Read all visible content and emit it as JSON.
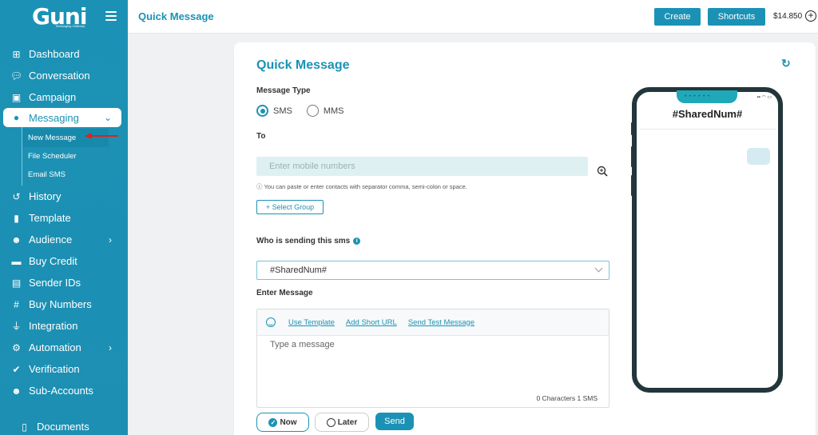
{
  "sidebar": {
    "logo": "Guni",
    "logo_sub": "Messaging Gateway",
    "items": [
      {
        "label": "Dashboard",
        "icon": "dashboard-icon"
      },
      {
        "label": "Conversation",
        "icon": "chat-icon"
      },
      {
        "label": "Campaign",
        "icon": "inbox-icon"
      },
      {
        "label": "Messaging",
        "icon": "message-icon",
        "active": true,
        "expanded": true
      },
      {
        "label": "History",
        "icon": "history-icon"
      },
      {
        "label": "Template",
        "icon": "file-icon"
      },
      {
        "label": "Audience",
        "icon": "users-icon",
        "has_children": true
      },
      {
        "label": "Buy Credit",
        "icon": "card-icon"
      },
      {
        "label": "Sender IDs",
        "icon": "id-badge-icon"
      },
      {
        "label": "Buy Numbers",
        "icon": "hash-icon"
      },
      {
        "label": "Integration",
        "icon": "plug-icon"
      },
      {
        "label": "Automation",
        "icon": "robot-icon",
        "has_children": true
      },
      {
        "label": "Verification",
        "icon": "check-circle-icon"
      },
      {
        "label": "Sub-Accounts",
        "icon": "sub-accounts-icon"
      },
      {
        "label": "Documents",
        "icon": "document-icon"
      }
    ],
    "subitems": [
      {
        "label": "New Message",
        "current": true
      },
      {
        "label": "File Scheduler"
      },
      {
        "label": "Email SMS"
      }
    ]
  },
  "topbar": {
    "title": "Quick Message",
    "create_label": "Create",
    "shortcuts_label": "Shortcuts",
    "balance": "$14.850"
  },
  "form": {
    "title": "Quick Message",
    "message_type_label": "Message Type",
    "sms_label": "SMS",
    "mms_label": "MMS",
    "selected_type": "SMS",
    "to_label": "To",
    "to_placeholder": "Enter mobile numbers",
    "to_hint": "You can paste or enter contacts with separator comma, semi-colon or space.",
    "select_group_label": "Select Group",
    "sender_label": "Who is sending this sms",
    "sender_value": "#SharedNum#",
    "enter_message_label": "Enter Message",
    "use_template": "Use Template",
    "add_short_url": "Add Short URL",
    "send_test": "Send Test Message",
    "message_placeholder": "Type a message",
    "counter": "0 Characters  1 SMS",
    "now_label": "Now",
    "later_label": "Later",
    "send_label": "Send"
  },
  "preview": {
    "sender": "#SharedNum#"
  },
  "colors": {
    "brand": "#1b92b5",
    "sidebar": "#1b92b5",
    "phone_frame": "#22363b",
    "bubble": "#d4ebf1",
    "pointer_arrow": "#e02020"
  }
}
